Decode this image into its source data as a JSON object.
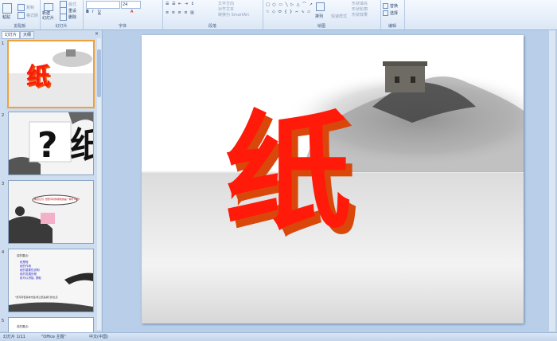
{
  "ribbon": {
    "clipboard": {
      "label": "剪贴板",
      "paste": "粘贴",
      "copy": "复制",
      "format_painter": "格式刷"
    },
    "slides": {
      "label": "幻灯片",
      "new_slide": "新建\n幻灯片",
      "layout": "版式",
      "reset": "重设",
      "delete": "删除"
    },
    "font": {
      "label": "字体",
      "size": "24"
    },
    "paragraph": {
      "label": "段落",
      "text_direction": "文字方向",
      "align_text": "对齐文本",
      "smartart": "转换为 SmartArt"
    },
    "drawing": {
      "label": "绘图",
      "arrange": "排列",
      "quick_styles": "快速样式",
      "shape_fill": "形状填充",
      "shape_outline": "形状轮廓",
      "shape_effects": "形状效果"
    },
    "editing": {
      "label": "编辑",
      "replace": "替换",
      "select": "选择"
    }
  },
  "left_pane": {
    "tabs": [
      "幻灯片",
      "大纲"
    ],
    "slides": [
      {
        "num": "1",
        "title": "纸"
      },
      {
        "num": "2",
        "text": "? 纸"
      },
      {
        "num": "3",
        "bubble": "看见它们, 想想平时你用到的是一种什么纸?"
      },
      {
        "num": "4",
        "heading": "讲的要点:",
        "lines": [
          "纸是啥",
          "纸的作用",
          "纸的重要性说明",
          "纸的发展历程",
          "纸可以拼接, 提取"
        ],
        "note": "*纸可有很多种方面,能让纸是我们的生活"
      },
      {
        "num": "5",
        "heading": "讲的要点:"
      }
    ]
  },
  "slide": {
    "title": "纸",
    "colors": {
      "face": "#ff1a0a",
      "side": "#e0520a"
    }
  },
  "status": {
    "slide_count": "幻灯片 1/11",
    "theme": "\"Office 主题\"",
    "language": "中文(中国)"
  }
}
